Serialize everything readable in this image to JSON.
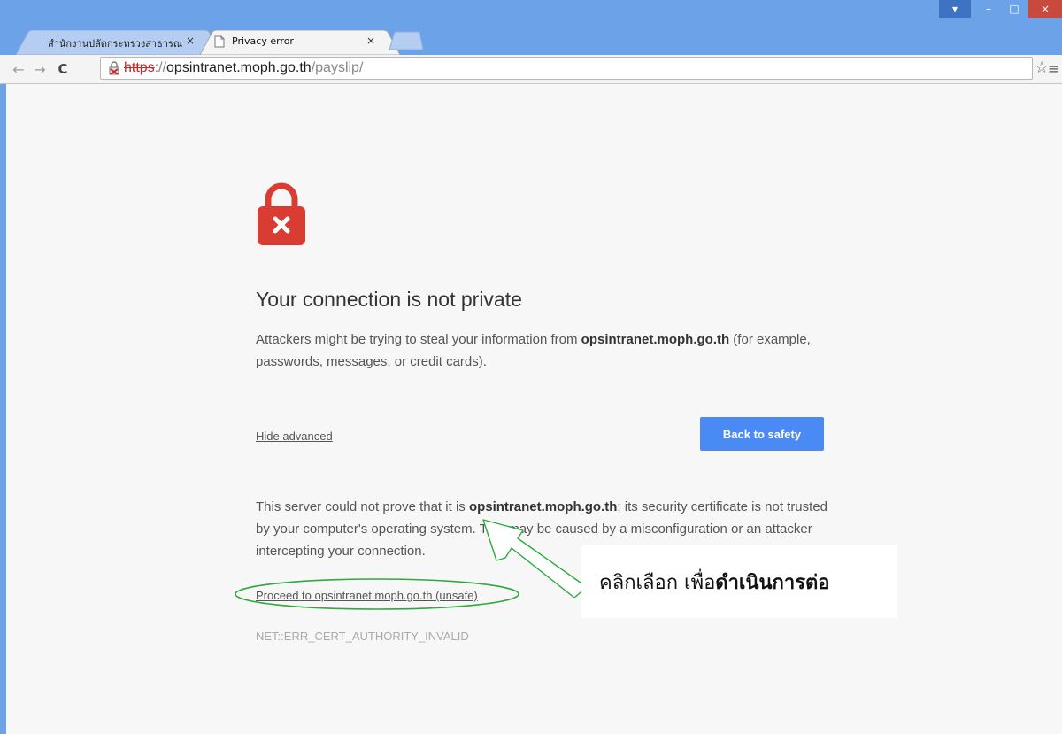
{
  "tabs": [
    {
      "label": "สำนักงานปลัดกระทรวงสาธารณ",
      "active": false
    },
    {
      "label": "Privacy error",
      "active": true
    }
  ],
  "tab_close_glyph": "×",
  "window_controls": {
    "menu": "▾",
    "minimize": "–",
    "maximize": "□",
    "close": "×"
  },
  "toolbar": {
    "back": "←",
    "forward": "→",
    "reload": "C",
    "star": "☆",
    "menu": "≡"
  },
  "address_bar": {
    "scheme": "https",
    "separator": "://",
    "host": "opsintranet.moph.go.th",
    "path": "/payslip/"
  },
  "interstitial": {
    "heading": "Your connection is not private",
    "desc_pre": "Attackers might be trying to steal your information from ",
    "desc_host": "opsintranet.moph.go.th",
    "desc_post": " (for example, passwords, messages, or credit cards).",
    "hide_advanced": "Hide advanced",
    "back_button": "Back to safety",
    "details_pre": "This server could not prove that it is ",
    "details_host": "opsintranet.moph.go.th",
    "details_post": "; its security certificate is not trusted by your computer's operating system. This may be caused by a misconfiguration or an attacker intercepting your connection.",
    "proceed_link": "Proceed to opsintranet.moph.go.th (unsafe)",
    "error_code": "NET::ERR_CERT_AUTHORITY_INVALID"
  },
  "annotation": {
    "text_normal": "คลิกเลือก เพื่อ",
    "text_bold": "ดำเนินการต่อ",
    "outline_color": "#2eaa3c"
  },
  "colors": {
    "accent": "#4a8af4",
    "lock": "#d93c32",
    "frame": "#6ca2e8"
  },
  "icons": [
    "lock-error-icon",
    "page-icon",
    "star-icon",
    "menu-icon",
    "back-icon",
    "forward-icon",
    "reload-icon"
  ]
}
